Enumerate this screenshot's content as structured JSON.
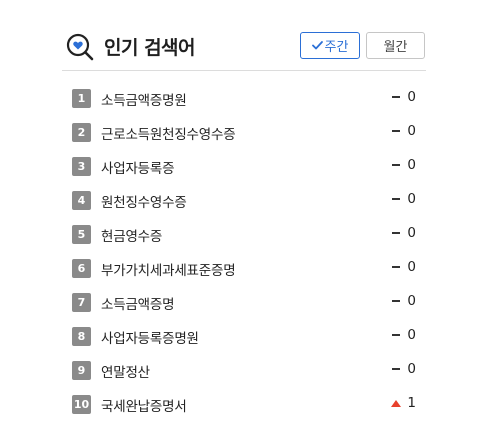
{
  "header": {
    "title": "인기 검색어",
    "icon": "search-heart-icon",
    "weekly_label": "주간",
    "monthly_label": "월간",
    "selected_period": "주간",
    "accent_color": "#2b6fd6"
  },
  "keywords": [
    {
      "rank": "1",
      "term": "소득금액증명원",
      "trend": "same",
      "change": "0"
    },
    {
      "rank": "2",
      "term": "근로소득원천징수영수증",
      "trend": "same",
      "change": "0"
    },
    {
      "rank": "3",
      "term": "사업자등록증",
      "trend": "same",
      "change": "0"
    },
    {
      "rank": "4",
      "term": "원천징수영수증",
      "trend": "same",
      "change": "0"
    },
    {
      "rank": "5",
      "term": "현금영수증",
      "trend": "same",
      "change": "0"
    },
    {
      "rank": "6",
      "term": "부가가치세과세표준증명",
      "trend": "same",
      "change": "0"
    },
    {
      "rank": "7",
      "term": "소득금액증명",
      "trend": "same",
      "change": "0"
    },
    {
      "rank": "8",
      "term": "사업자등록증명원",
      "trend": "same",
      "change": "0"
    },
    {
      "rank": "9",
      "term": "연말정산",
      "trend": "same",
      "change": "0"
    },
    {
      "rank": "10",
      "term": "국세완납증명서",
      "trend": "up",
      "change": "1"
    }
  ],
  "colors": {
    "rank_badge": "#8a8a8a",
    "up_arrow": "#e8412c"
  }
}
